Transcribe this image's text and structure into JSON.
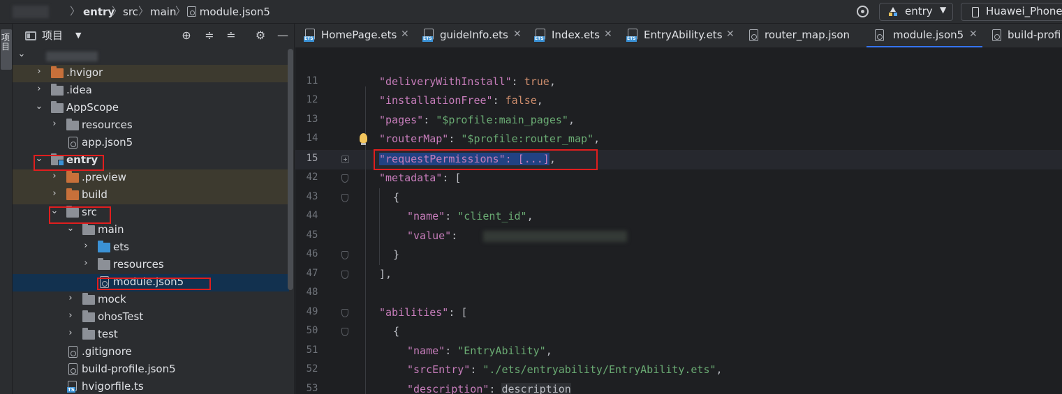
{
  "breadcrumb": {
    "items": [
      "entry",
      "src",
      "main",
      "module.json5"
    ]
  },
  "toolbar": {
    "run_config": "entry",
    "device": "Huawei_Phone"
  },
  "left_strip": {
    "project_tab": "项目"
  },
  "project_panel": {
    "title": "项目",
    "tree": [
      {
        "label": ".hvigor"
      },
      {
        "label": ".idea"
      },
      {
        "label": "AppScope"
      },
      {
        "label": "resources"
      },
      {
        "label": "app.json5"
      },
      {
        "label": "entry"
      },
      {
        "label": ".preview"
      },
      {
        "label": "build"
      },
      {
        "label": "src"
      },
      {
        "label": "main"
      },
      {
        "label": "ets"
      },
      {
        "label": "resources"
      },
      {
        "label": "module.json5"
      },
      {
        "label": "mock"
      },
      {
        "label": "ohosTest"
      },
      {
        "label": "test"
      },
      {
        "label": ".gitignore"
      },
      {
        "label": "build-profile.json5"
      },
      {
        "label": "hvigorfile.ts"
      }
    ]
  },
  "editor": {
    "tabs": [
      {
        "label": "HomePage.ets",
        "close": "✕"
      },
      {
        "label": "guideInfo.ets",
        "close": "✕"
      },
      {
        "label": "Index.ets",
        "close": "✕"
      },
      {
        "label": "EntryAbility.ets",
        "close": "✕"
      },
      {
        "label": "router_map.json",
        "close": ""
      },
      {
        "label": "module.json5",
        "close": "✕"
      },
      {
        "label": "build-profi",
        "close": ""
      }
    ],
    "line_numbers": [
      "11",
      "12",
      "13",
      "14",
      "15",
      "42",
      "43",
      "44",
      "45",
      "46",
      "47",
      "48",
      "49",
      "50",
      "51",
      "52",
      "53"
    ],
    "code": {
      "l11": {
        "key": "\"deliveryWithInstall\"",
        "sep": ": ",
        "val": "true",
        "end": ","
      },
      "l12": {
        "key": "\"installationFree\"",
        "sep": ": ",
        "val": "false",
        "end": ","
      },
      "l13": {
        "key": "\"pages\"",
        "sep": ": ",
        "val": "\"$profile:main_pages\"",
        "end": ","
      },
      "l14": {
        "key": "\"routerMap\"",
        "sep": ": ",
        "val": "\"$profile:router_map\"",
        "end": ","
      },
      "l15": {
        "selected": "\"requestPermissions\": [...]",
        "end": ","
      },
      "l42": {
        "key": "\"metadata\"",
        "sep": ": ["
      },
      "l43": {
        "text": "{"
      },
      "l44": {
        "key": "\"name\"",
        "sep": ": ",
        "val": "\"client_id\"",
        "end": ","
      },
      "l45": {
        "key": "\"value\"",
        "sep": ":"
      },
      "l46": {
        "text": "}"
      },
      "l47": {
        "text": "],"
      },
      "l49": {
        "key": "\"abilities\"",
        "sep": ": ["
      },
      "l50": {
        "text": "{"
      },
      "l51": {
        "key": "\"name\"",
        "sep": ": ",
        "val": "\"EntryAbility\"",
        "end": ","
      },
      "l52": {
        "key": "\"srcEntry\"",
        "sep": ": ",
        "val": "\"./ets/entryability/EntryAbility.ets\"",
        "end": ","
      },
      "l53": {
        "key": "\"description\"",
        "sep": ": ",
        "val": "description"
      }
    }
  },
  "colors": {
    "key": "#c77dbb",
    "string": "#6aab73",
    "keyword": "#cf8e6d",
    "selection": "#214283",
    "highlight_box": "#e01e1e",
    "accent": "#3574f0"
  },
  "icons": [
    "target-icon",
    "chevron-down-icon",
    "phone-icon",
    "folder-icon",
    "json-file-icon",
    "ts-file-icon",
    "ets-file-icon",
    "crosshair-icon",
    "expand-all-icon",
    "collapse-all-icon",
    "gear-icon",
    "minimize-icon",
    "lightbulb-icon",
    "fold-icon"
  ]
}
